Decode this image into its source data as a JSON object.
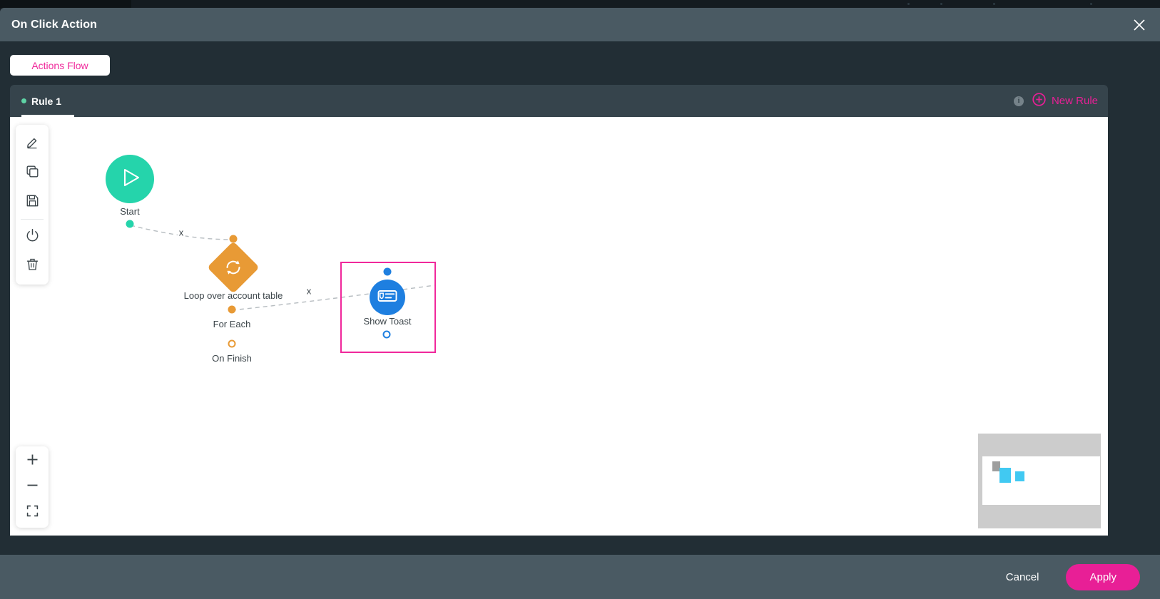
{
  "window": {
    "title": "On Click Action",
    "close_icon": "close-icon"
  },
  "flow_tabs": [
    {
      "label": "Actions Flow",
      "active": true
    }
  ],
  "rules_bar": {
    "tabs": [
      {
        "label": "Rule 1",
        "active": true,
        "status_color": "#5ed3a5"
      }
    ],
    "info_icon": "info-icon",
    "info_glyph": "i",
    "new_rule_label": "New Rule",
    "new_rule_icon": "plus-circle-icon"
  },
  "toolbar": {
    "items": [
      {
        "name": "edit-tool",
        "icon": "pencil-icon"
      },
      {
        "name": "duplicate-tool",
        "icon": "copy-icon"
      },
      {
        "name": "save-tool",
        "icon": "save-icon"
      },
      {
        "name": "enable-disable-tool",
        "icon": "power-icon"
      },
      {
        "name": "delete-tool",
        "icon": "trash-icon"
      }
    ]
  },
  "zoom_controls": {
    "zoom_in_icon": "plus-icon",
    "zoom_out_icon": "minus-icon",
    "fit_screen_icon": "fit-screen-icon"
  },
  "graph": {
    "nodes": [
      {
        "id": "start",
        "label": "Start",
        "type": "start",
        "icon": "play-icon",
        "color": "#25d4ab",
        "selected": false
      },
      {
        "id": "loop",
        "label": "Loop over account table",
        "type": "loop",
        "icon": "refresh-loop-icon",
        "color": "#e89a35",
        "selected": false,
        "ports": [
          {
            "label": "For Each",
            "filled": true
          },
          {
            "label": "On Finish",
            "filled": false
          }
        ]
      },
      {
        "id": "toast",
        "label": "Show Toast",
        "type": "action",
        "icon": "toast-notification-icon",
        "color": "#1e7fe0",
        "selected": true
      }
    ],
    "edges": [
      {
        "from": "start",
        "to": "loop",
        "delete_label": "x"
      },
      {
        "from": "loop",
        "to": "toast",
        "delete_label": "x"
      }
    ]
  },
  "minimap": {
    "nodes": [
      {
        "color": "#9e9e9e"
      },
      {
        "color": "#41c9f2"
      },
      {
        "color": "#41c9f2"
      }
    ]
  },
  "footer": {
    "cancel_label": "Cancel",
    "apply_label": "Apply",
    "apply_color": "#e81f96"
  }
}
